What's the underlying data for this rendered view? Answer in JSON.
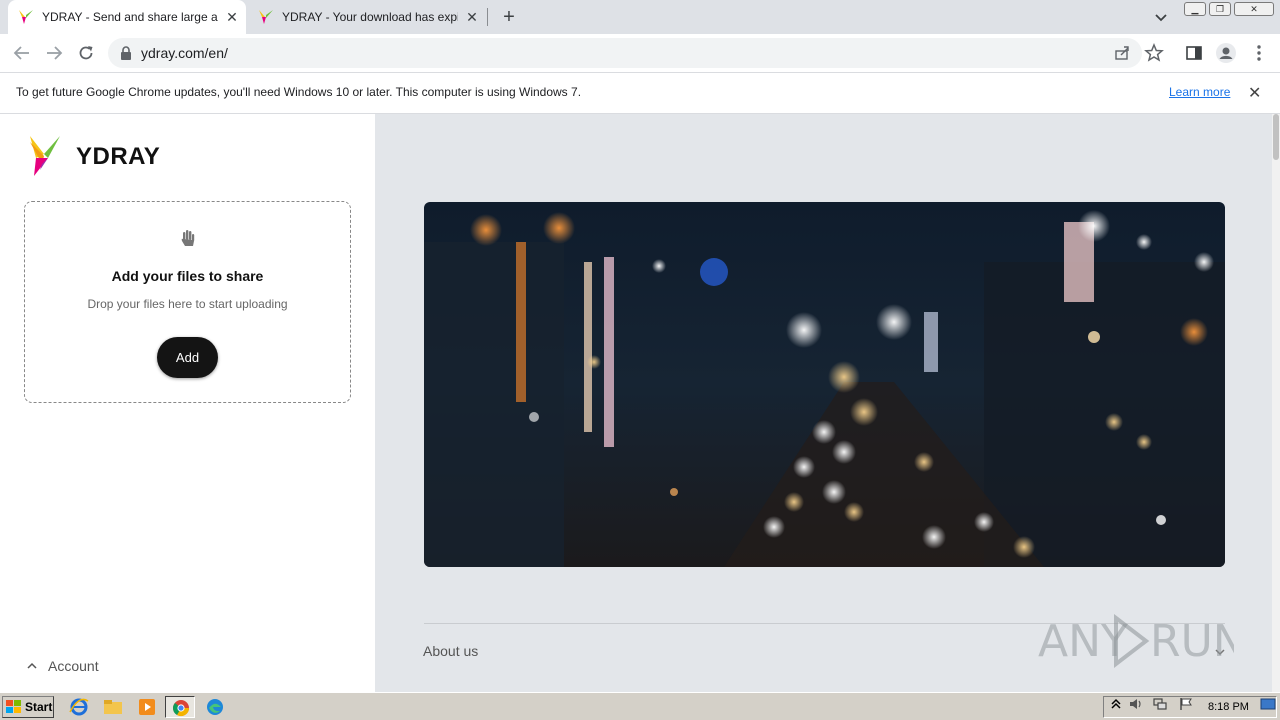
{
  "browser": {
    "tabs": [
      {
        "title": "YDRAY - Send and share large and b",
        "active": true
      },
      {
        "title": "YDRAY - Your download has expired",
        "active": false
      }
    ],
    "url": "ydray.com/en/"
  },
  "infobar": {
    "message": "To get future Google Chrome updates, you'll need Windows 10 or later. This computer is using Windows 7.",
    "link": "Learn more"
  },
  "sidebar": {
    "logo_text": "YDRAY",
    "dropzone": {
      "title": "Add your files to share",
      "subtitle": "Drop your files here to start uploading",
      "button": "Add"
    },
    "account_label": "Account"
  },
  "main": {
    "about_label": "About us"
  },
  "watermark": "ANY RUN",
  "taskbar": {
    "start_label": "Start",
    "clock": "8:18 PM"
  },
  "colors": {
    "logo_yellow": "#f5c518",
    "logo_pink": "#e6007e",
    "logo_green": "#6fbf3f",
    "main_bg": "#e3e6ea",
    "link_blue": "#1a73e8"
  }
}
